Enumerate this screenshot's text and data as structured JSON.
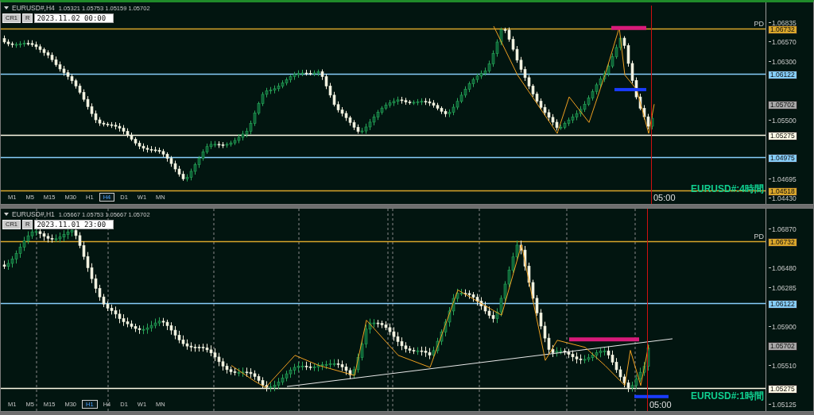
{
  "panes": [
    {
      "header": {
        "symbol": "EURUSD#,H4",
        "ohlc": "1.05321 1.05753 1.05159 1.05702"
      },
      "buttons": [
        "CR1",
        "R"
      ],
      "date_field": {
        "value": "2023.11.02 00:00"
      },
      "price_ticks": [
        "1.06835",
        "1.06570",
        "1.06300",
        "1.05500",
        "1.04695",
        "1.04430"
      ],
      "levels": [
        {
          "kind": "line",
          "price": "1.06732",
          "color": "#d9a62b"
        },
        {
          "kind": "line",
          "price": "1.06122",
          "color": "#87cefa"
        },
        {
          "kind": "tag",
          "price": "1.05702",
          "color": "#a8a8a8"
        },
        {
          "kind": "line",
          "price": "1.05275",
          "color": "#fffbe6"
        },
        {
          "kind": "line",
          "price": "1.04975",
          "color": "#87cefa"
        },
        {
          "kind": "line",
          "price": "1.04518",
          "color": "#d9a62b"
        }
      ],
      "pd_label": "PD",
      "time_label": "05:00",
      "title_label": "EURUSD#:4時間",
      "timeframes": [
        {
          "label": "M1",
          "selected": false
        },
        {
          "label": "M5",
          "selected": false
        },
        {
          "label": "M15",
          "selected": false
        },
        {
          "label": "M30",
          "selected": false
        },
        {
          "label": "H1",
          "selected": false
        },
        {
          "label": "H4",
          "selected": true
        },
        {
          "label": "D1",
          "selected": false
        },
        {
          "label": "W1",
          "selected": false
        },
        {
          "label": "MN",
          "selected": false
        }
      ]
    },
    {
      "header": {
        "symbol": "EURUSD#,H1",
        "ohlc": "1.05667 1.05753 1.05667 1.05702"
      },
      "buttons": [
        "CR1",
        "R"
      ],
      "date_field": {
        "value": "2023.11.01 23:00"
      },
      "price_ticks": [
        "1.06870",
        "1.06480",
        "1.06285",
        "1.05900",
        "1.05510",
        "1.05125"
      ],
      "levels": [
        {
          "kind": "line",
          "price": "1.06732",
          "color": "#d9a62b"
        },
        {
          "kind": "line",
          "price": "1.06122",
          "color": "#87cefa"
        },
        {
          "kind": "tag",
          "price": "1.05702",
          "color": "#a8a8a8"
        },
        {
          "kind": "line",
          "price": "1.05275",
          "color": "#fffbe6"
        }
      ],
      "pd_label": "PD",
      "time_label": "05:00",
      "title_label": "EURUSD#:1時間",
      "timeframes": [
        {
          "label": "M1",
          "selected": false
        },
        {
          "label": "M5",
          "selected": false
        },
        {
          "label": "M15",
          "selected": false
        },
        {
          "label": "M30",
          "selected": false
        },
        {
          "label": "H1",
          "selected": true
        },
        {
          "label": "H4",
          "selected": false
        },
        {
          "label": "D1",
          "selected": false
        },
        {
          "label": "W1",
          "selected": false
        },
        {
          "label": "MN",
          "selected": false
        }
      ]
    }
  ]
}
